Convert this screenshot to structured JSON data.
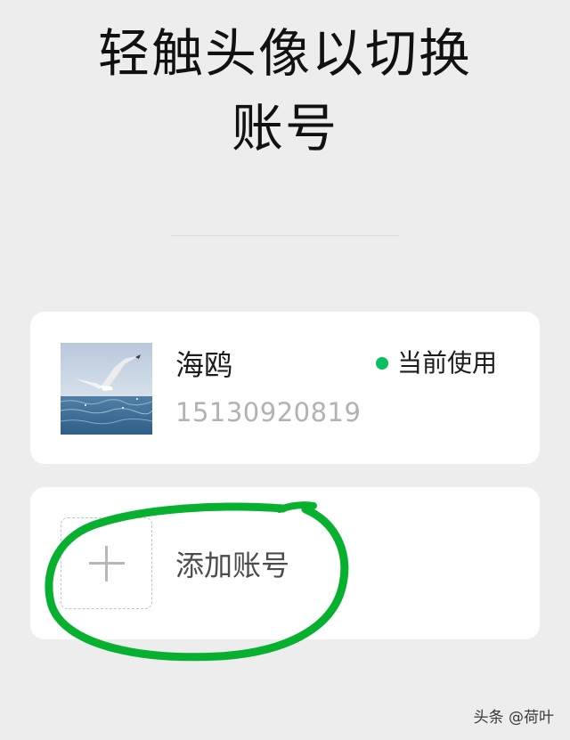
{
  "header": {
    "title_line1": "轻触头像以切换",
    "title_line2": "账号"
  },
  "current_account": {
    "name": "海鸥",
    "phone": "15130920819",
    "status": "当前使用",
    "status_color": "#07c160",
    "avatar": "seagull-photo"
  },
  "add_account": {
    "label": "添加账号",
    "icon": "plus-icon"
  },
  "annotation": {
    "description": "",
    "color": "#07b12f"
  },
  "watermark": "头条 @荷叶"
}
